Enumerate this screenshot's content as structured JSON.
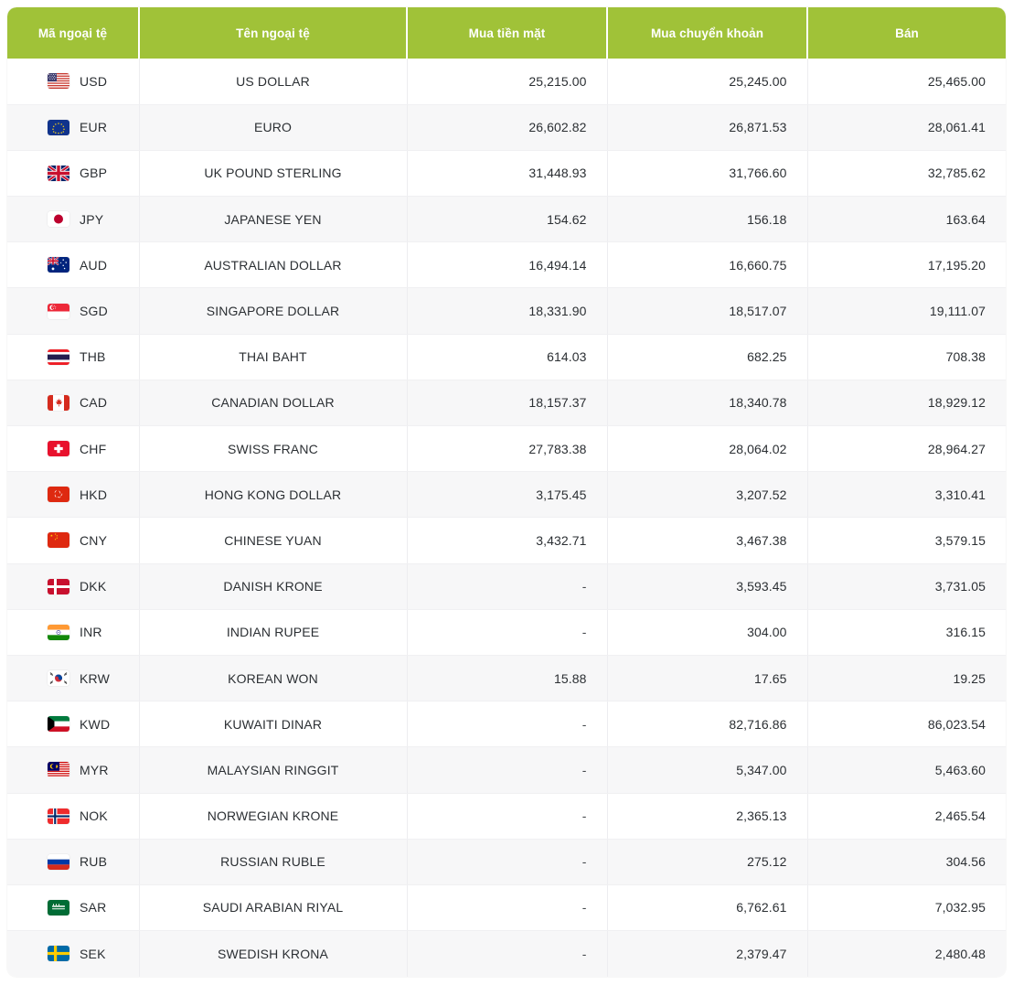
{
  "table": {
    "columns": [
      {
        "key": "code",
        "label": "Mã ngoại tệ"
      },
      {
        "key": "name",
        "label": "Tên ngoại tệ"
      },
      {
        "key": "cash",
        "label": "Mua tiền mặt"
      },
      {
        "key": "transfer",
        "label": "Mua chuyển khoản"
      },
      {
        "key": "sell",
        "label": "Bán"
      }
    ],
    "header_bg": "#A0C238",
    "header_text_color": "#FFFFFF",
    "row_alt_bg": "#F7F7F8",
    "rows": [
      {
        "flag": "flag-us",
        "code": "USD",
        "name": "US DOLLAR",
        "cash": "25,215.00",
        "transfer": "25,245.00",
        "sell": "25,465.00"
      },
      {
        "flag": "flag-eu",
        "code": "EUR",
        "name": "EURO",
        "cash": "26,602.82",
        "transfer": "26,871.53",
        "sell": "28,061.41"
      },
      {
        "flag": "flag-gb",
        "code": "GBP",
        "name": "UK POUND STERLING",
        "cash": "31,448.93",
        "transfer": "31,766.60",
        "sell": "32,785.62"
      },
      {
        "flag": "flag-jp",
        "code": "JPY",
        "name": "JAPANESE YEN",
        "cash": "154.62",
        "transfer": "156.18",
        "sell": "163.64"
      },
      {
        "flag": "flag-au",
        "code": "AUD",
        "name": "AUSTRALIAN DOLLAR",
        "cash": "16,494.14",
        "transfer": "16,660.75",
        "sell": "17,195.20"
      },
      {
        "flag": "flag-sg",
        "code": "SGD",
        "name": "SINGAPORE DOLLAR",
        "cash": "18,331.90",
        "transfer": "18,517.07",
        "sell": "19,111.07"
      },
      {
        "flag": "flag-th",
        "code": "THB",
        "name": "THAI BAHT",
        "cash": "614.03",
        "transfer": "682.25",
        "sell": "708.38"
      },
      {
        "flag": "flag-ca",
        "code": "CAD",
        "name": "CANADIAN DOLLAR",
        "cash": "18,157.37",
        "transfer": "18,340.78",
        "sell": "18,929.12"
      },
      {
        "flag": "flag-ch",
        "code": "CHF",
        "name": "SWISS FRANC",
        "cash": "27,783.38",
        "transfer": "28,064.02",
        "sell": "28,964.27"
      },
      {
        "flag": "flag-hk",
        "code": "HKD",
        "name": "HONG KONG DOLLAR",
        "cash": "3,175.45",
        "transfer": "3,207.52",
        "sell": "3,310.41"
      },
      {
        "flag": "flag-cn",
        "code": "CNY",
        "name": "CHINESE YUAN",
        "cash": "3,432.71",
        "transfer": "3,467.38",
        "sell": "3,579.15"
      },
      {
        "flag": "flag-dk",
        "code": "DKK",
        "name": "DANISH KRONE",
        "cash": "-",
        "transfer": "3,593.45",
        "sell": "3,731.05"
      },
      {
        "flag": "flag-in",
        "code": "INR",
        "name": "INDIAN RUPEE",
        "cash": "-",
        "transfer": "304.00",
        "sell": "316.15"
      },
      {
        "flag": "flag-kr",
        "code": "KRW",
        "name": "KOREAN WON",
        "cash": "15.88",
        "transfer": "17.65",
        "sell": "19.25"
      },
      {
        "flag": "flag-kw",
        "code": "KWD",
        "name": "KUWAITI DINAR",
        "cash": "-",
        "transfer": "82,716.86",
        "sell": "86,023.54"
      },
      {
        "flag": "flag-my",
        "code": "MYR",
        "name": "MALAYSIAN RINGGIT",
        "cash": "-",
        "transfer": "5,347.00",
        "sell": "5,463.60"
      },
      {
        "flag": "flag-no",
        "code": "NOK",
        "name": "NORWEGIAN KRONE",
        "cash": "-",
        "transfer": "2,365.13",
        "sell": "2,465.54"
      },
      {
        "flag": "flag-ru",
        "code": "RUB",
        "name": "RUSSIAN RUBLE",
        "cash": "-",
        "transfer": "275.12",
        "sell": "304.56"
      },
      {
        "flag": "flag-sa",
        "code": "SAR",
        "name": "SAUDI ARABIAN RIYAL",
        "cash": "-",
        "transfer": "6,762.61",
        "sell": "7,032.95"
      },
      {
        "flag": "flag-se",
        "code": "SEK",
        "name": "SWEDISH KRONA",
        "cash": "-",
        "transfer": "2,379.47",
        "sell": "2,480.48"
      }
    ]
  }
}
